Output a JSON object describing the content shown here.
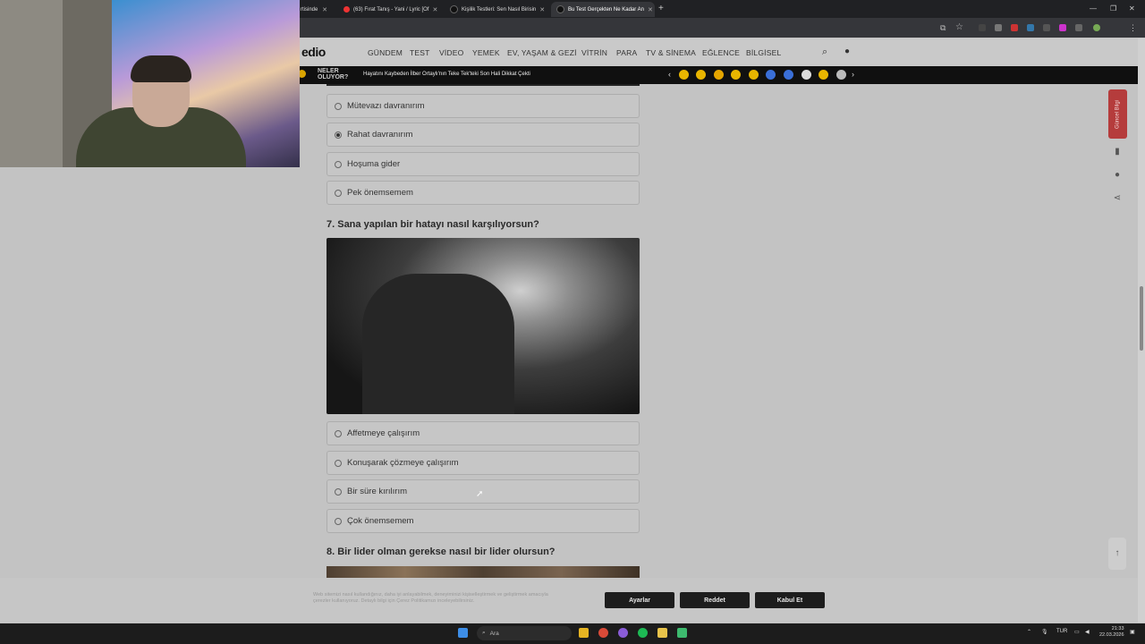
{
  "browser": {
    "tabs": [
      {
        "label": "rtisinde"
      },
      {
        "label": "(63) Fırat Tanış - Yani / Lyric [Of"
      },
      {
        "label": "Kişilik Testleri: Sen Nasıl Birisin"
      },
      {
        "label": "Bu Test Gerçekten Ne Kadar An"
      }
    ],
    "new_tab": "+"
  },
  "site": {
    "logo": "edio",
    "nav": [
      "GÜNDEM",
      "TEST",
      "VİDEO",
      "YEMEK",
      "EV, YAŞAM & GEZİ",
      "VİTRİN",
      "PARA",
      "TV & SİNEMA",
      "EĞLENCE",
      "BİLGİSEL"
    ],
    "ticker": {
      "badge_line1": "NELER",
      "badge_line2": "OLUYOR?",
      "headline": "Hayatını Kaybeden İlber Ortaylı'nın Teke Tek'teki Son Hali Dikkat Çekti"
    }
  },
  "quiz": {
    "prev_options": [
      {
        "label": "Mütevazı davranırım",
        "selected": false
      },
      {
        "label": "Rahat davranırım",
        "selected": true
      },
      {
        "label": "Hoşuma gider",
        "selected": false
      },
      {
        "label": "Pek önemsemem",
        "selected": false
      }
    ],
    "q7": {
      "title": "7. Sana yapılan bir hatayı nasıl karşılıyorsun?",
      "options": [
        {
          "label": "Affetmeye çalışırım",
          "selected": false
        },
        {
          "label": "Konuşarak çözmeye çalışırım",
          "selected": false
        },
        {
          "label": "Bir süre kırılırım",
          "selected": false
        },
        {
          "label": "Çok önemsemem",
          "selected": false
        }
      ]
    },
    "q8": {
      "title": "8. Bir lider olman gerekse nasıl bir lider olursun?"
    }
  },
  "side": {
    "guncel_label": "Güncel Bilgi"
  },
  "cookie": {
    "text_line1": "Web sitemizi nasıl kullandığınız, daha iyi anlayabilmek, deneyiminizi kişiselleştirmek ve geliştirmek amacıyla",
    "text_line2": "çerezler kullanıyoruz. Detaylı bilgi için Çerez Politikamızı inceleyebilirsiniz.",
    "buttons": [
      "Ayarlar",
      "Reddet",
      "Kabul Et"
    ]
  },
  "taskbar": {
    "search_placeholder": "Ara",
    "lang": "TUR",
    "time": "21:33",
    "date": "22.03.2026"
  },
  "colors": {
    "accent_red": "#b53c3c",
    "page_bg": "#c3c3c3",
    "dark_button": "#1d1d1d"
  }
}
